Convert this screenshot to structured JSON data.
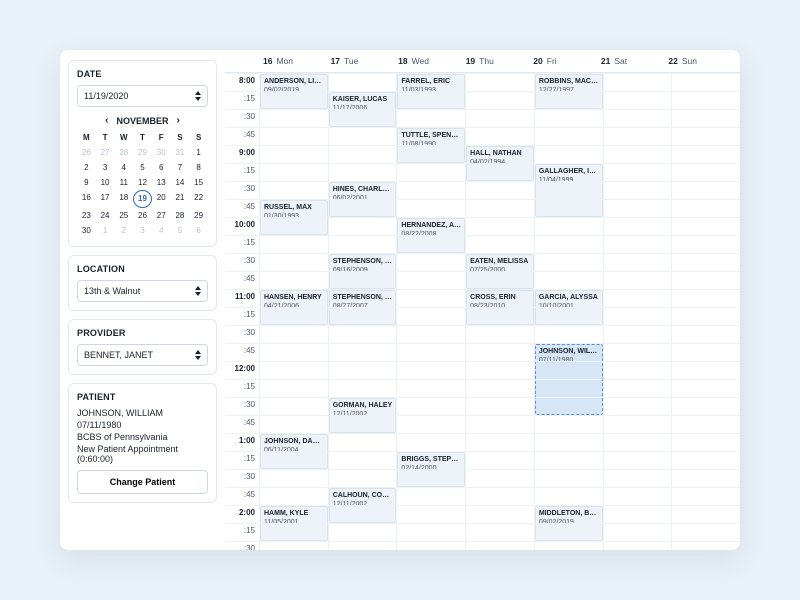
{
  "sidebar": {
    "date_label": "DATE",
    "date_value": "11/19/2020",
    "month_label": "NOVEMBER",
    "dow": [
      "M",
      "T",
      "W",
      "T",
      "F",
      "S",
      "S"
    ],
    "days": [
      {
        "n": "26",
        "muted": true
      },
      {
        "n": "27",
        "muted": true
      },
      {
        "n": "28",
        "muted": true
      },
      {
        "n": "29",
        "muted": true
      },
      {
        "n": "30",
        "muted": true
      },
      {
        "n": "31",
        "muted": true
      },
      {
        "n": "1"
      },
      {
        "n": "2"
      },
      {
        "n": "3"
      },
      {
        "n": "4"
      },
      {
        "n": "5"
      },
      {
        "n": "6"
      },
      {
        "n": "7"
      },
      {
        "n": "8"
      },
      {
        "n": "9"
      },
      {
        "n": "10"
      },
      {
        "n": "11"
      },
      {
        "n": "12"
      },
      {
        "n": "13"
      },
      {
        "n": "14"
      },
      {
        "n": "15"
      },
      {
        "n": "16"
      },
      {
        "n": "17"
      },
      {
        "n": "18"
      },
      {
        "n": "19",
        "selected": true
      },
      {
        "n": "20"
      },
      {
        "n": "21"
      },
      {
        "n": "22"
      },
      {
        "n": "23"
      },
      {
        "n": "24"
      },
      {
        "n": "25"
      },
      {
        "n": "26"
      },
      {
        "n": "27"
      },
      {
        "n": "28"
      },
      {
        "n": "29"
      },
      {
        "n": "30"
      },
      {
        "n": "1",
        "muted": true
      },
      {
        "n": "2",
        "muted": true
      },
      {
        "n": "3",
        "muted": true
      },
      {
        "n": "4",
        "muted": true
      },
      {
        "n": "5",
        "muted": true
      },
      {
        "n": "6",
        "muted": true
      }
    ],
    "location_label": "LOCATION",
    "location_value": "13th & Walnut",
    "provider_label": "PROVIDER",
    "provider_value": "BENNET, JANET",
    "patient_label": "PATIENT",
    "patient_name": "JOHNSON, WILLIAM",
    "patient_dob": "07/11/1980",
    "patient_insurance": "BCBS of Pennsylvania",
    "patient_appt_type": "New Patient Appointment (0:60:00)",
    "change_patient": "Change Patient"
  },
  "calendar": {
    "columns": [
      {
        "num": "16",
        "dow": "Mon"
      },
      {
        "num": "17",
        "dow": "Tue"
      },
      {
        "num": "18",
        "dow": "Wed"
      },
      {
        "num": "19",
        "dow": "Thu"
      },
      {
        "num": "20",
        "dow": "Fri"
      },
      {
        "num": "21",
        "dow": "Sat"
      },
      {
        "num": "22",
        "dow": "Sun"
      }
    ],
    "time_labels": [
      "8:00",
      ":15",
      ":30",
      ":45",
      "9:00",
      ":15",
      ":30",
      ":45",
      "10:00",
      ":15",
      ":30",
      ":45",
      "11:00",
      ":15",
      ":30",
      ":45",
      "12:00",
      ":15",
      ":30",
      ":45",
      "1:00",
      ":15",
      ":30",
      ":45",
      "2:00",
      ":15",
      ":30"
    ],
    "appointments": [
      {
        "col": 0,
        "row": 0,
        "span": 2,
        "name": "ANDERSON, LIN…",
        "sub": "09/02/2019"
      },
      {
        "col": 1,
        "row": 1,
        "span": 2,
        "name": "KAISER, LUCAS",
        "sub": "11/17/2006"
      },
      {
        "col": 2,
        "row": 0,
        "span": 2,
        "name": "FARREL, ERIC",
        "sub": "11/03/1993"
      },
      {
        "col": 4,
        "row": 0,
        "span": 2,
        "name": "ROBBINS, MAC…",
        "sub": "12/27/1997"
      },
      {
        "col": 2,
        "row": 3,
        "span": 2,
        "name": "TUTTLE, SPEN…",
        "sub": "11/08/1990"
      },
      {
        "col": 3,
        "row": 4,
        "span": 2,
        "name": "HALL, NATHAN",
        "sub": "04/02/1994"
      },
      {
        "col": 1,
        "row": 6,
        "span": 2,
        "name": "HINES, CHARLO…",
        "sub": "06/02/2001"
      },
      {
        "col": 4,
        "row": 5,
        "span": 3,
        "name": "GALLAGHER, IS…",
        "sub": "11/04/1999"
      },
      {
        "col": 0,
        "row": 7,
        "span": 2,
        "name": "RUSSEL, MAX",
        "sub": "01/30/1993"
      },
      {
        "col": 2,
        "row": 8,
        "span": 2,
        "name": "HERNANDEZ, A…",
        "sub": "08/22/2008"
      },
      {
        "col": 1,
        "row": 10,
        "span": 2,
        "name": "STEPHENSON, …",
        "sub": "09/16/2009"
      },
      {
        "col": 3,
        "row": 10,
        "span": 2,
        "name": "EATEN, MELISSA",
        "sub": "07/25/2000"
      },
      {
        "col": 0,
        "row": 12,
        "span": 2,
        "name": "HANSEN, HENRY",
        "sub": "04/21/2006"
      },
      {
        "col": 1,
        "row": 12,
        "span": 2,
        "name": "STEPHENSON, …",
        "sub": "08/27/2007"
      },
      {
        "col": 3,
        "row": 12,
        "span": 2,
        "name": "CROSS, ERIN",
        "sub": "08/23/2010"
      },
      {
        "col": 4,
        "row": 12,
        "span": 2,
        "name": "GARCIA, ALYSSA",
        "sub": "10/10/2001"
      },
      {
        "col": 4,
        "row": 15,
        "span": 4,
        "name": "JOHNSON, WIL…",
        "sub": "07/11/1980",
        "dragging": true
      },
      {
        "col": 1,
        "row": 18,
        "span": 2,
        "name": "GORMAN, HALEY",
        "sub": "12/11/2002"
      },
      {
        "col": 0,
        "row": 20,
        "span": 2,
        "name": "JOHNSON, DAL…",
        "sub": "06/11/2004"
      },
      {
        "col": 2,
        "row": 21,
        "span": 2,
        "name": "BRIGGS, STEPH…",
        "sub": "02/14/2000"
      },
      {
        "col": 1,
        "row": 23,
        "span": 2,
        "name": "CALHOUN, COLIN",
        "sub": "12/11/2002"
      },
      {
        "col": 0,
        "row": 24,
        "span": 2,
        "name": "HAMM, KYLE",
        "sub": "11/05/2001"
      },
      {
        "col": 4,
        "row": 24,
        "span": 2,
        "name": "MIDDLETON, BR…",
        "sub": "09/02/2019"
      }
    ]
  }
}
